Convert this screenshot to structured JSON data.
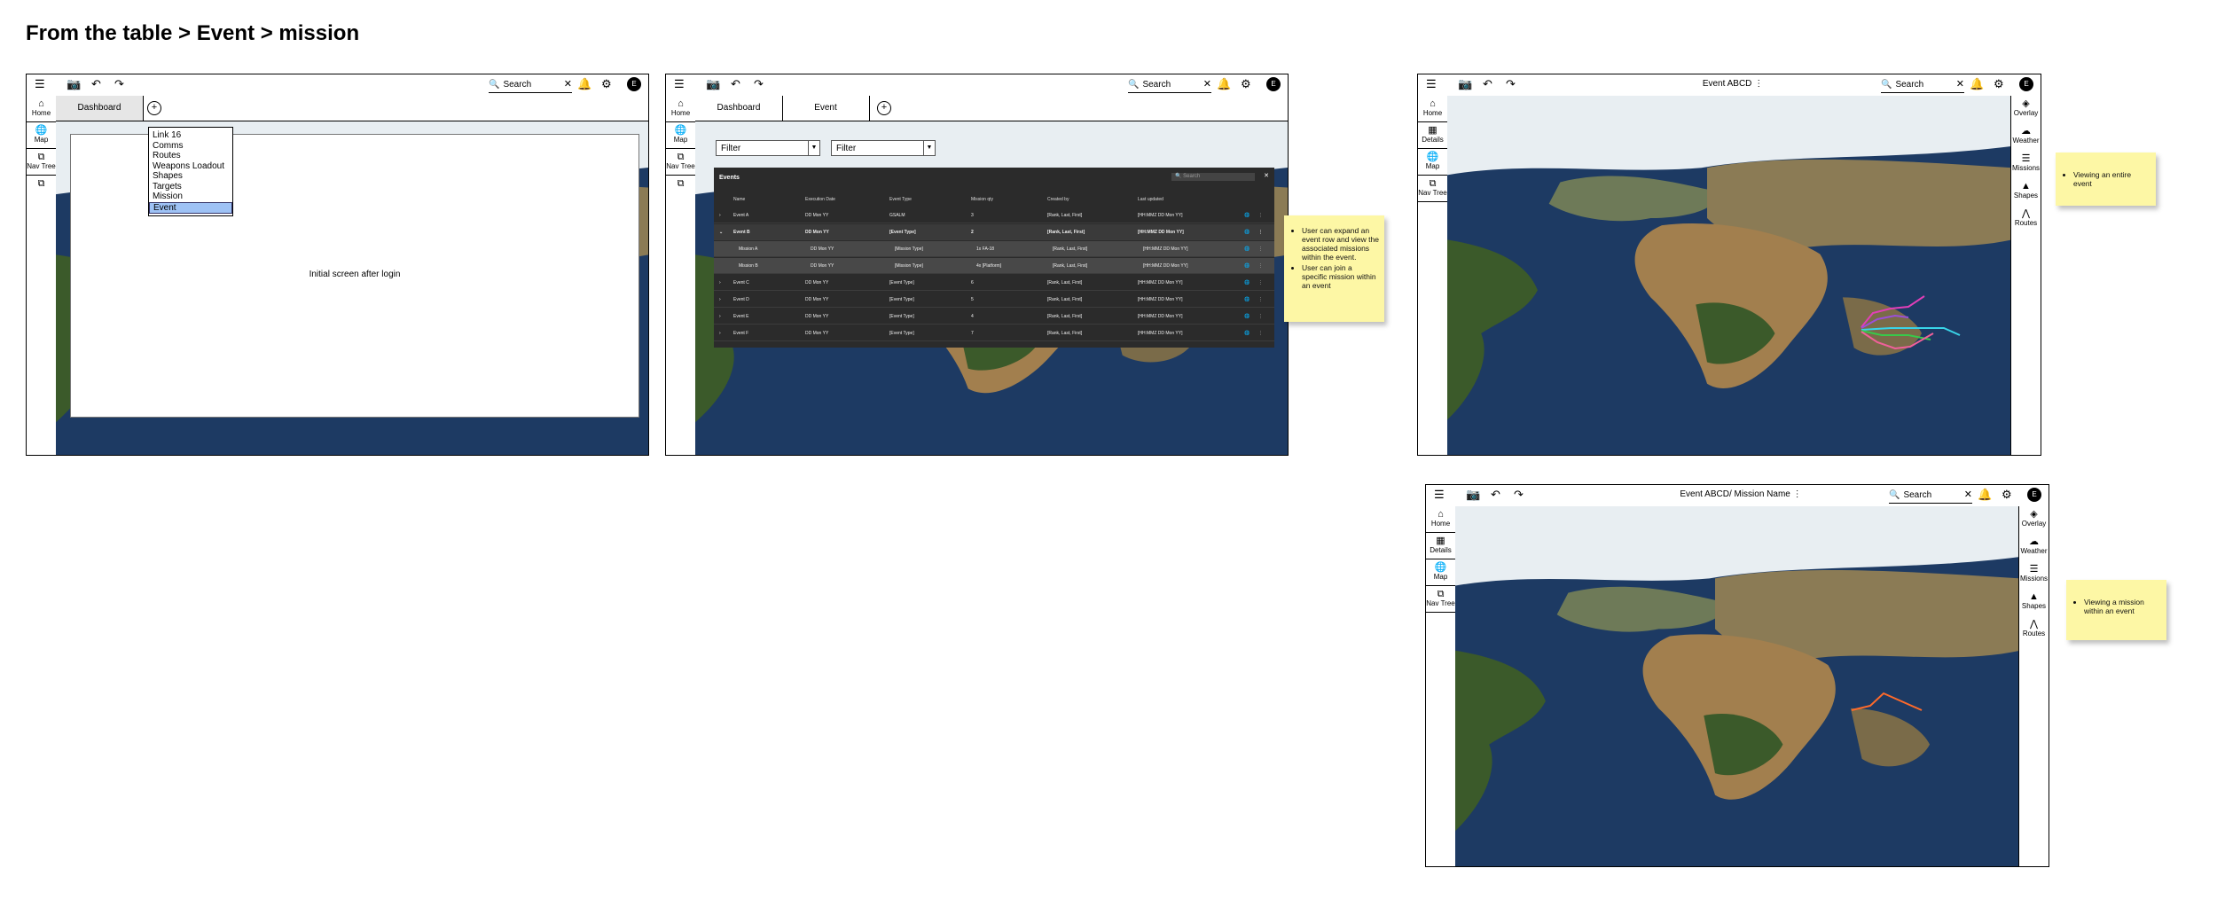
{
  "page_title": "From the table > Event > mission",
  "toolbar": {
    "search_label": "Search",
    "avatar_initial": "E"
  },
  "nav": {
    "home": "Home",
    "map": "Map",
    "nav_tree": "Nav Tree",
    "details": "Details"
  },
  "right_nav": {
    "overlay": "Overlay",
    "weather": "Weather",
    "missions": "Missions",
    "shapes": "Shapes",
    "routes": "Routes"
  },
  "screen1": {
    "tab_dashboard": "Dashboard",
    "dropdown_items": [
      "Link 16",
      "Comms",
      "Routes",
      "Weapons Loadout",
      "Shapes",
      "Targets",
      "Mission",
      "Event"
    ],
    "selected_item": "Event",
    "panel_text": "Initial screen after login"
  },
  "screen2": {
    "tab_dashboard": "Dashboard",
    "tab_event": "Event",
    "filter1": "Filter",
    "filter2": "Filter",
    "table_title": "Events",
    "search_placeholder": "Search",
    "columns": [
      "Name",
      "Execution Date",
      "Event Type",
      "Mission qty",
      "Created by",
      "Last updated"
    ],
    "rows": [
      {
        "cells": [
          "Event A",
          "DD Mon YY",
          "GSALM",
          "3",
          "[Rank, Last, First]",
          "[HH:MMZ DD Mon YY]"
        ],
        "kind": "normal"
      },
      {
        "cells": [
          "Event B",
          "DD Mon YY",
          "[Event Type]",
          "2",
          "[Rank, Last, First]",
          "[HH:MMZ DD Mon YY]"
        ],
        "kind": "expanded"
      },
      {
        "cells": [
          "Mission A",
          "DD Mon YY",
          "[Mission Type]",
          "1x FA-18",
          "[Rank, Last, First]",
          "[HH:MMZ DD Mon YY]"
        ],
        "kind": "mission"
      },
      {
        "cells": [
          "Mission B",
          "DD Mon YY",
          "[Mission Type]",
          "4x [Platform]",
          "[Rank, Last, First]",
          "[HH:MMZ DD Mon YY]"
        ],
        "kind": "mission"
      },
      {
        "cells": [
          "Event C",
          "DD Mon YY",
          "[Event Type]",
          "6",
          "[Rank, Last, First]",
          "[HH:MMZ DD Mon YY]"
        ],
        "kind": "normal"
      },
      {
        "cells": [
          "Event D",
          "DD Mon YY",
          "[Event Type]",
          "5",
          "[Rank, Last, First]",
          "[HH:MMZ DD Mon YY]"
        ],
        "kind": "normal"
      },
      {
        "cells": [
          "Event E",
          "DD Mon YY",
          "[Event Type]",
          "4",
          "[Rank, Last, First]",
          "[HH:MMZ DD Mon YY]"
        ],
        "kind": "normal"
      },
      {
        "cells": [
          "Event F",
          "DD Mon YY",
          "[Event Type]",
          "7",
          "[Rank, Last, First]",
          "[HH:MMZ DD Mon YY]"
        ],
        "kind": "normal"
      }
    ]
  },
  "screen3": {
    "title": "Event ABCD"
  },
  "screen4": {
    "title": "Event ABCD/ Mission Name"
  },
  "notes": {
    "note1": [
      "User can expand an event row and view the associated missions within the event.",
      "User can join a specific mission within an event"
    ],
    "note2": [
      "Viewing an entire event"
    ],
    "note3": [
      "Viewing a mission within an event"
    ]
  },
  "colors": {
    "ocean": "#1d3a63",
    "land": "#a27f4e",
    "forest": "#3b5a2a",
    "ice": "#e8eef2",
    "sticky": "#fdf7a5",
    "table_bg": "#2b2b2b",
    "dropdown_selected": "#9ec2f5"
  },
  "route_colors": [
    "#e23fb8",
    "#9b4fd9",
    "#39d4e8",
    "#37c94a",
    "#f0609a"
  ],
  "mission_route_color": "#ff6a2a"
}
